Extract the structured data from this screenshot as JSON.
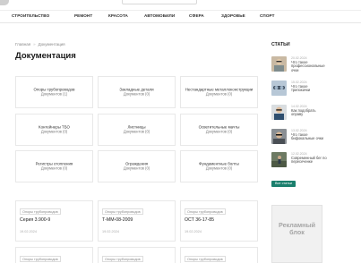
{
  "nav": {
    "items": [
      "Строительство",
      "Ремонт",
      "Красота",
      "Автомобили",
      "Сфера",
      "Здоровье",
      "Спорт"
    ]
  },
  "breadcrumb": {
    "home": "Главная",
    "separator": "»",
    "current": "Документация"
  },
  "page_title": "Документация",
  "categories": [
    {
      "title": "Опоры трубопроводов",
      "count": "Документов (1)"
    },
    {
      "title": "Закладные детали",
      "count": "Документов (0)"
    },
    {
      "title": "Нестандартные металлоконструкции",
      "count": "Документов (0)"
    },
    {
      "title": "Контейнеры ТБО",
      "count": "Документов (0)"
    },
    {
      "title": "Листницы",
      "count": "Документов (0)"
    },
    {
      "title": "Осветительные мачты",
      "count": "Документов (0)"
    },
    {
      "title": "Регистры отопления",
      "count": "Документов (0)"
    },
    {
      "title": "Ограждения",
      "count": "Документов (0)"
    },
    {
      "title": "Фундаментные болты",
      "count": "Документов (0)"
    }
  ],
  "documents": [
    {
      "tag": "Опоры трубопроводов",
      "title": "Серия 3.900-9",
      "date": "19.02.2024"
    },
    {
      "tag": "Опоры трубопроводов",
      "title": "Т-ММ-08-2009",
      "date": "19.02.2024"
    },
    {
      "tag": "Опоры трубопроводов",
      "title": "ОСТ 36-17-85",
      "date": "19.02.2024"
    }
  ],
  "documents_row2": [
    {
      "tag": "Опоры трубопроводов"
    },
    {
      "tag": "Опоры трубопроводов"
    },
    {
      "tag": "Опоры трубопроводов"
    }
  ],
  "sidebar": {
    "heading": "Статьи",
    "articles": [
      {
        "date": "20.02.2024",
        "title": "Что такое профессиональные очки"
      },
      {
        "date": "15.02.2024",
        "title": "Что такое трипокачки"
      },
      {
        "date": "14.02.2024",
        "title": "Как подобрать оправу"
      },
      {
        "date": "13.02.2024",
        "title": "Что такое бифокальные очки"
      },
      {
        "date": "12.02.2024",
        "title": "Современный бег по пересеченке"
      }
    ],
    "all_button": "Все статьи",
    "ad_text": "Рекламный блок"
  },
  "colors": {
    "accent": "#1b7f6d",
    "text": "#222222",
    "muted": "#888888"
  }
}
